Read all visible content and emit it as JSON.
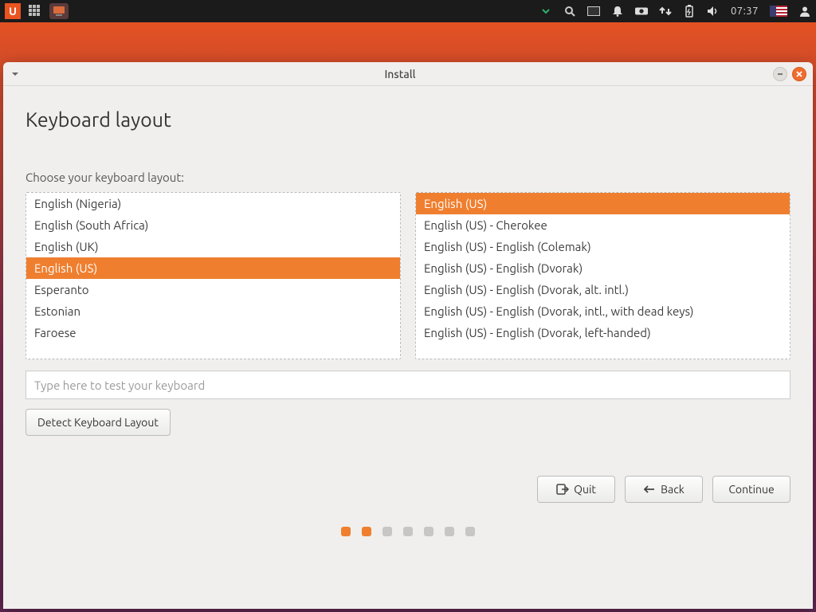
{
  "panel": {
    "clock": "07:37"
  },
  "window": {
    "title": "Install",
    "heading": "Keyboard layout",
    "prompt": "Choose your keyboard layout:",
    "layouts": [
      "English (Nigeria)",
      "English (South Africa)",
      "English (UK)",
      "English (US)",
      "Esperanto",
      "Estonian",
      "Faroese"
    ],
    "layouts_selected": "English (US)",
    "variants": [
      "English (US)",
      "English (US) - Cherokee",
      "English (US) - English (Colemak)",
      "English (US) - English (Dvorak)",
      "English (US) - English (Dvorak, alt. intl.)",
      "English (US) - English (Dvorak, intl., with dead keys)",
      "English (US) - English (Dvorak, left-handed)"
    ],
    "variants_selected": "English (US)",
    "test_placeholder": "Type here to test your keyboard",
    "detect": "Detect Keyboard Layout",
    "quit": "Quit",
    "back": "Back",
    "continue": "Continue",
    "steps_total": 7,
    "steps_done": 2
  }
}
